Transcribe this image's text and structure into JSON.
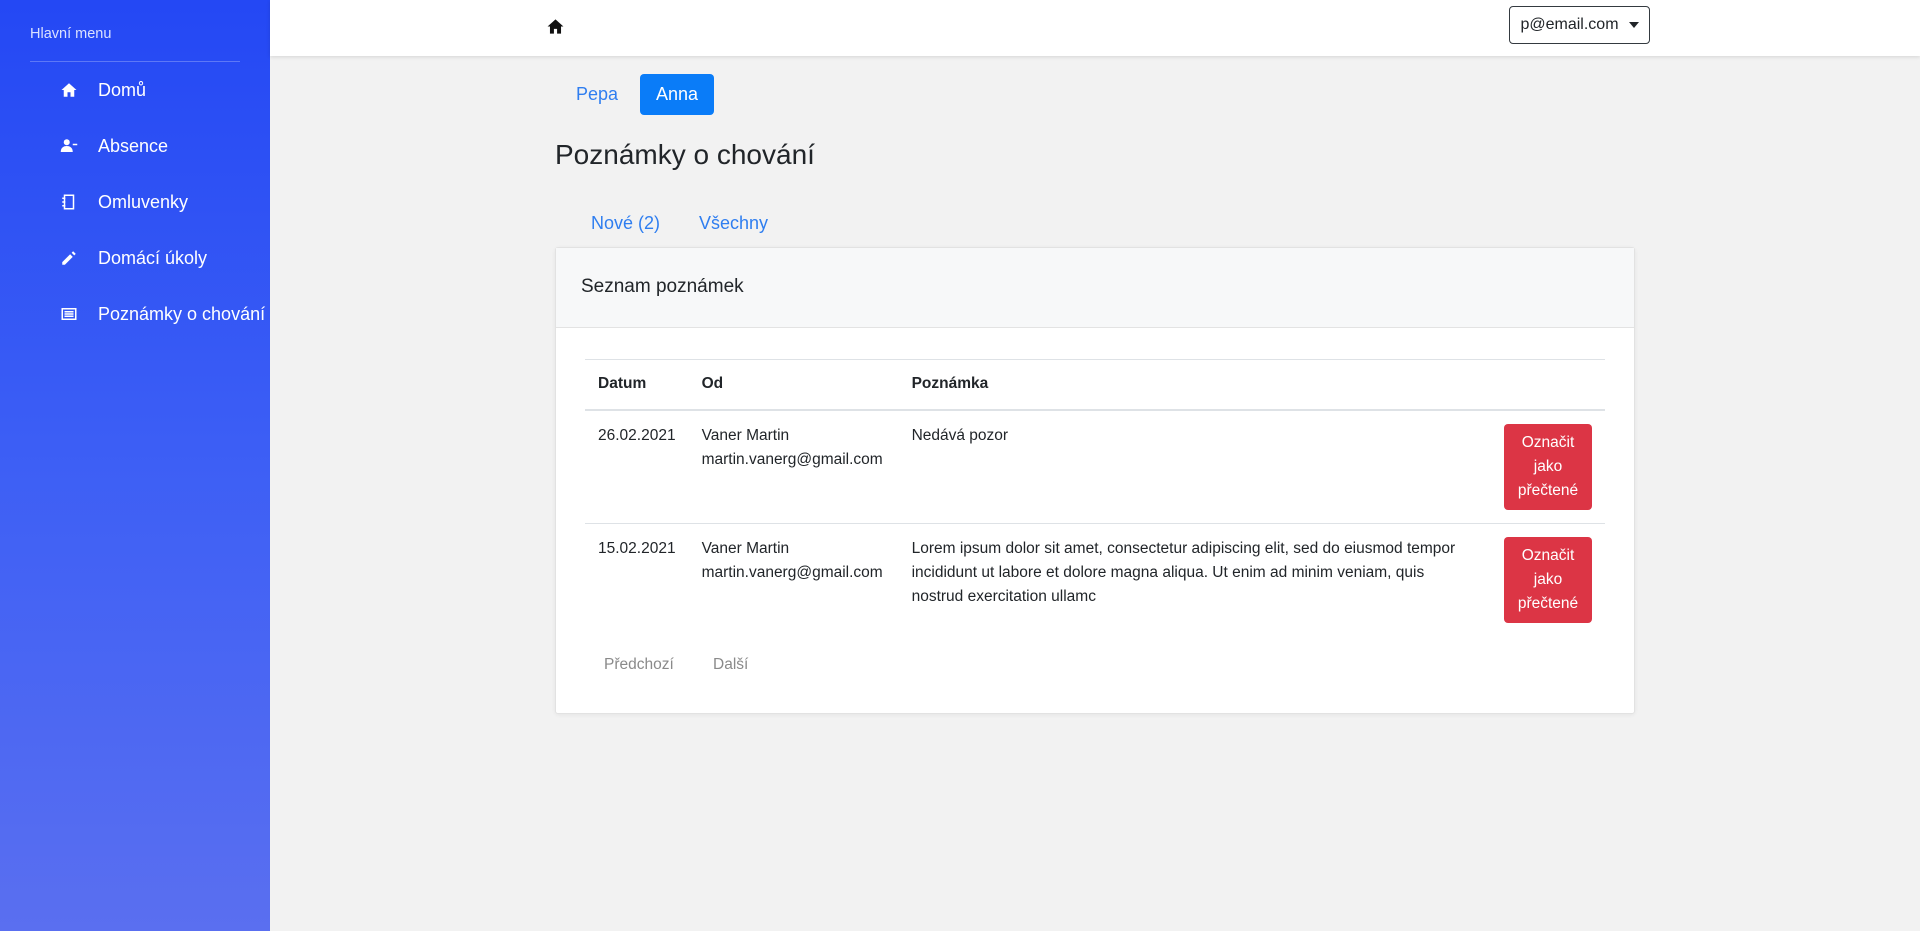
{
  "sidebar": {
    "heading": "Hlavní menu",
    "items": [
      {
        "label": "Domů",
        "icon": "home-icon"
      },
      {
        "label": "Absence",
        "icon": "user-minus-icon"
      },
      {
        "label": "Omluvenky",
        "icon": "notebook-icon"
      },
      {
        "label": "Domácí úkoly",
        "icon": "pencil-icon"
      },
      {
        "label": "Poznámky o chování",
        "icon": "list-icon"
      }
    ]
  },
  "topbar": {
    "home_icon": "home-icon",
    "user_email": "p@email.com"
  },
  "children_tabs": [
    {
      "label": "Pepa",
      "active": false
    },
    {
      "label": "Anna",
      "active": true
    }
  ],
  "page_title": "Poznámky o chování",
  "filter_tabs": [
    {
      "label": "Nové (2)"
    },
    {
      "label": "Všechny"
    }
  ],
  "card": {
    "title": "Seznam poznámek",
    "columns": [
      "Datum",
      "Od",
      "Poznámka",
      ""
    ],
    "rows": [
      {
        "date": "26.02.2021",
        "from_name": "Vaner Martin",
        "from_email": "martin.vanerg@gmail.com",
        "note": "Nedává pozor",
        "action": "Označit jako přečtené"
      },
      {
        "date": "15.02.2021",
        "from_name": "Vaner Martin",
        "from_email": "martin.vanerg@gmail.com",
        "note": "Lorem ipsum dolor sit amet, consectetur adipiscing elit, sed do eiusmod tempor incididunt ut labore et dolore magna aliqua. Ut enim ad minim veniam, quis nostrud exercitation ullamc",
        "action": "Označit jako přečtené"
      }
    ],
    "pagination": {
      "prev": "Předchozí",
      "next": "Další"
    }
  },
  "colors": {
    "sidebar_top": "#2448f4",
    "sidebar_bottom": "#5a6ff0",
    "primary": "#0a7cf8",
    "link": "#2f7ef0",
    "danger": "#dc3545"
  }
}
